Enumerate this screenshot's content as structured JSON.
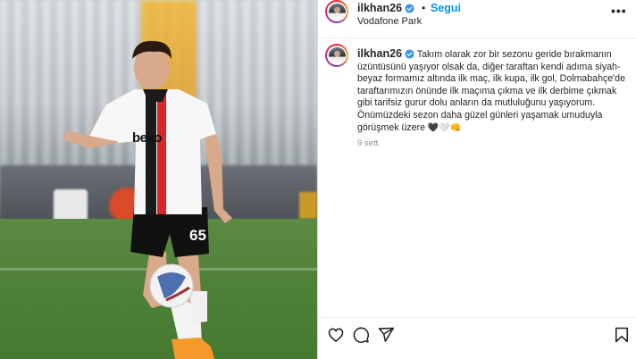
{
  "post": {
    "username": "ilkhan26",
    "follow_label": "Segui",
    "separator": "•",
    "location": "Vodafone Park",
    "more_label": "•••",
    "caption_username": "ilkhan26",
    "caption_text": "Takım olarak zor bir sezonu geride bırakmanın üzüntüsünü yaşıyor olsak da, diğer taraftan kendi adıma siyah-beyaz formamız altında ilk maç, ilk kupa, ilk gol, Dolmabahçe'de taraftarımızın önünde ilk maçıma çıkma ve ilk derbime çıkmak gibi tarifsiz gurur dolu anların da mutluluğunu yaşıyorum. Önümüzdeki sezon daha güzel günleri yaşamak umuduyla görüşmek üzere",
    "caption_emojis": "🖤🤍👊",
    "time_ago": "9 sett."
  },
  "photo": {
    "jersey_sponsor": "beko",
    "shirt_number": "65"
  },
  "colors": {
    "accent": "#0095f6",
    "verified": "#3897f0",
    "text": "#262626",
    "muted": "#8e8e8e"
  },
  "icons": [
    "verified-badge-icon",
    "more-icon",
    "heart-icon",
    "comment-icon",
    "share-icon",
    "bookmark-icon"
  ]
}
